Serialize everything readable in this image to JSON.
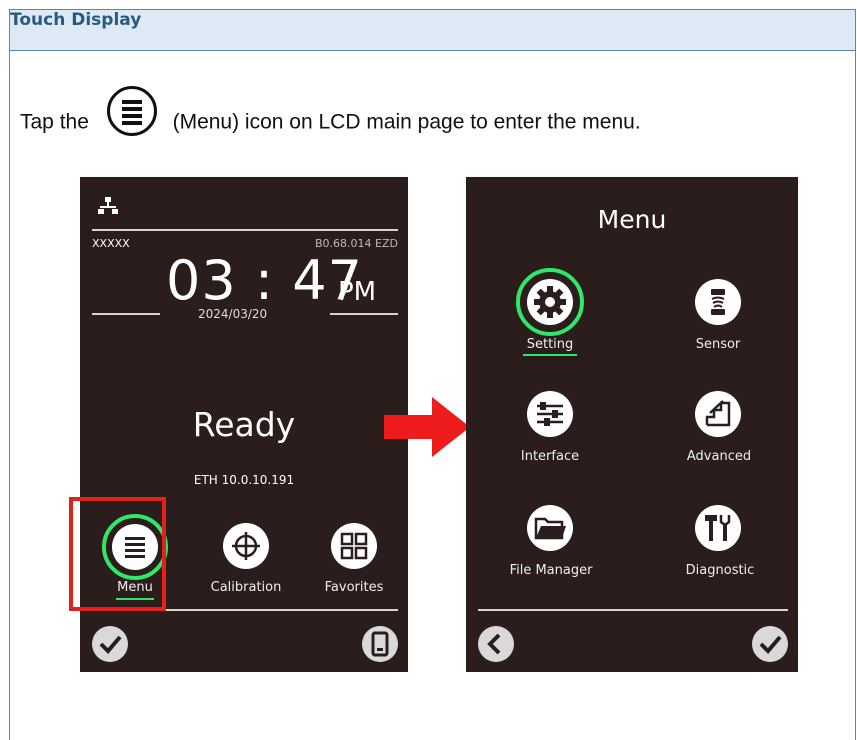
{
  "section": {
    "title": "Touch Display"
  },
  "intro": {
    "before": "Tap the",
    "after": "(Menu) icon on LCD main page to enter the menu."
  },
  "main_screen": {
    "printer_name": "XXXXX",
    "firmware": "B0.68.014  EZD",
    "time": "03 : 47",
    "ampm": "PM",
    "date": "2024/03/20",
    "status": "Ready",
    "network": "ETH 10.0.10.191",
    "buttons": [
      {
        "label": "Menu",
        "icon": "menu-list-icon"
      },
      {
        "label": "Calibration",
        "icon": "crosshair-icon"
      },
      {
        "label": "Favorites",
        "icon": "grid-icon"
      }
    ]
  },
  "menu_screen": {
    "title": "Menu",
    "items": [
      {
        "label": "Setting",
        "icon": "gear-icon"
      },
      {
        "label": "Sensor",
        "icon": "sensor-icon"
      },
      {
        "label": "Interface",
        "icon": "sliders-icon"
      },
      {
        "label": "Advanced",
        "icon": "stairs-icon"
      },
      {
        "label": "File Manager",
        "icon": "folder-icon"
      },
      {
        "label": "Diagnostic",
        "icon": "tools-icon"
      }
    ]
  },
  "colors": {
    "screen_bg": "#2a1d1b",
    "highlight_green": "#2ee86a",
    "highlight_red": "#e0211d",
    "header_bg": "#dde9f4",
    "header_text": "#2b5a80"
  }
}
